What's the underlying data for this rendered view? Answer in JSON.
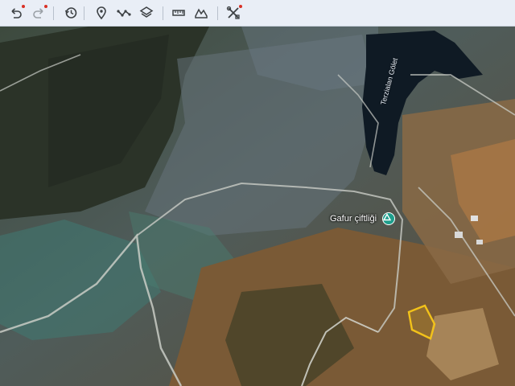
{
  "toolbar": {
    "icons": [
      "undo-icon",
      "redo-icon",
      "history-icon",
      "placemark-icon",
      "path-icon",
      "layers-icon",
      "ruler-icon",
      "terrain-icon",
      "tools-icon"
    ]
  },
  "map": {
    "lake_label": "Terzialan Gölet",
    "place_label": "Gafur çiftliği"
  },
  "colors": {
    "toolbar_bg": "#e9eef6",
    "notification_dot": "#d93025",
    "parcel_outline": "#f2c21a",
    "place_pin": "#1e9e8c",
    "lake": "#0f1a24"
  }
}
